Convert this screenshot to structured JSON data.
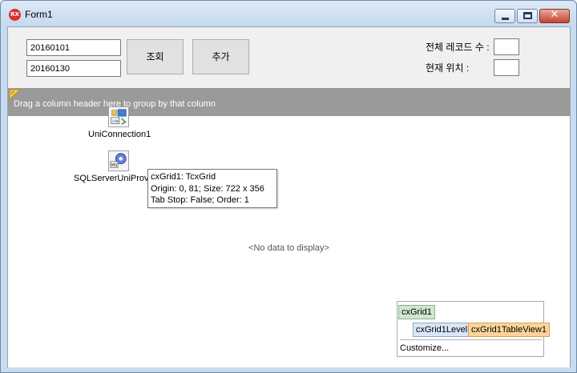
{
  "window": {
    "title": "Form1",
    "app_icon_text": "RX",
    "minimize_icon": "minimize-icon",
    "maximize_icon": "maximize-icon",
    "close_icon": "close-icon",
    "close_glyph": "✕"
  },
  "top_panel": {
    "date_from": "20160101",
    "date_to": "20160130",
    "search_button": "조회",
    "add_button": "추가",
    "total_records_label": "전체 레코드 수 :",
    "current_position_label": "현재 위치 :",
    "total_records_value": "",
    "current_position_value": ""
  },
  "grid": {
    "group_by_text": "Drag a column header here to group by that column",
    "no_data_text": "<No data to display>"
  },
  "components": [
    {
      "label": "UniConnection1",
      "icon": "uniconnection-icon"
    },
    {
      "label": "SQLServerUniProvic",
      "icon": "sqlserver-provider-icon"
    }
  ],
  "tooltip": {
    "line1": "cxGrid1: TcxGrid",
    "line2": "Origin: 0, 81; Size: 722 x 356",
    "line3": "Tab Stop: False; Order: 1"
  },
  "levels_panel": {
    "root": "cxGrid1",
    "level": "cxGrid1Level1",
    "view": "cxGrid1TableView1",
    "customize": "Customize..."
  },
  "colors": {
    "group_panel": "#9a9a9a",
    "close_button": "#c4432f",
    "view_highlight": "#fcd49a"
  }
}
